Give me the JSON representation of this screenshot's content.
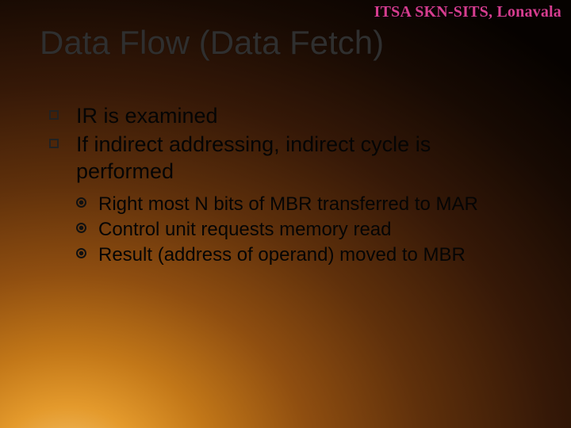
{
  "header": {
    "org": "ITSA SKN-SITS, Lonavala"
  },
  "title": "Data Flow (Data Fetch)",
  "bullets": [
    {
      "text": "IR is examined"
    },
    {
      "text": "If indirect addressing, indirect cycle is performed"
    }
  ],
  "subbullets": [
    {
      "text": "Right most N bits of MBR transferred to MAR"
    },
    {
      "text": "Control unit requests memory read"
    },
    {
      "text": "Result (address of operand) moved to MBR"
    }
  ]
}
